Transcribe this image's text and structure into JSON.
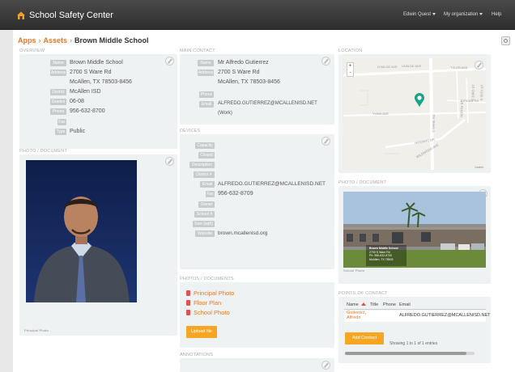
{
  "header": {
    "app_title": "School Safety Center",
    "user_menu": "Edwin Quest",
    "org_menu": "My organization",
    "help": "Help"
  },
  "breadcrumb": {
    "apps": "Apps",
    "assets": "Assets",
    "current": "Brown Middle School",
    "separator": "›"
  },
  "sections": {
    "overview": "Overview",
    "main_contact": "Main Contact",
    "location": "Location",
    "photo_doc_left": "Photo / Document",
    "devices": "Devices",
    "photo_doc_right": "Photo / Document",
    "photos_documents": "Photos / Documents",
    "annotations": "Annotations",
    "points_of_contact": "Points of Contact"
  },
  "overview": {
    "labels": {
      "name": "Name",
      "address": "Address",
      "district": "District",
      "grades": "Grades",
      "phone": "Phone",
      "fax": "Fax",
      "type": "Type"
    },
    "name": "Brown Middle School",
    "address_1": "2700 S Ware Rd",
    "address_2": "McAllen, TX 78503-8456",
    "district": "McAllen ISD",
    "grades": "06-08",
    "phone": "956-632-8700",
    "type": "Public"
  },
  "main_contact": {
    "labels": {
      "name": "Name",
      "address": "Address",
      "phone": "Phone",
      "email": "Email"
    },
    "name": "Mr Alfredo Gutierrez",
    "address_1": "2700 S Ware Rd",
    "address_2": "McAllen, TX 78503-8456",
    "email": "ALFREDO.GUTIERREZ@MCALLENISD.NET",
    "email_type": "(Work)"
  },
  "devices": {
    "labels": {
      "capacity": "Capacity",
      "closed": "Closed",
      "description": "Description",
      "district_no": "District #",
      "email": "Email",
      "fax": "Fax",
      "owner": "Owner",
      "school_no": "School #",
      "size": "Size (sqft)",
      "website": "Website"
    },
    "email": "ALFREDO.GUTIERREZ@MCALLENISD.NET",
    "fax": "956-632-8709",
    "website": "brown.mcallenisd.org"
  },
  "photo_left_caption": "Principal Photo",
  "photo_right_caption": "School Photo",
  "photo_right_overlay": [
    "Brown Middle School",
    "2700 S Ware Rd",
    "Ph: 956-632-8700",
    "McAllen, TX 78503"
  ],
  "documents": [
    "Principal Photo",
    "Floor Plan",
    "School Photo"
  ],
  "upload_button": "Upload file",
  "map": {
    "zoom_in": "+",
    "zoom_out": "-",
    "streets": [
      "LIVALDE AVE",
      "UVALDE AVE",
      "TYLER AVE",
      "S WARE RD",
      "YUMA AVE",
      "JORDAN RD",
      "HOWARD DR",
      "NORTH ST",
      "S 33RD ST",
      "S 35TH ST",
      "WILDWOOD AVE"
    ],
    "credit": "Leaflet"
  },
  "contacts": {
    "columns": [
      "Name",
      "Title",
      "Phone",
      "Email"
    ],
    "rows": [
      {
        "name_line1": "Gutierrez,",
        "name_line2": "Alfredo",
        "title": "",
        "phone": "",
        "email": "ALFREDO.GUTIERREZ@MCALLENISD.NET"
      }
    ],
    "add_button": "Add Contact",
    "entries_text": "Showing 1 to 1 of 1 entries"
  },
  "colors": {
    "accent": "#e87722",
    "button": "#f5a623",
    "panel": "#eef2f2",
    "header": "#3b3b3b",
    "map_marker": "#1aa38a"
  }
}
